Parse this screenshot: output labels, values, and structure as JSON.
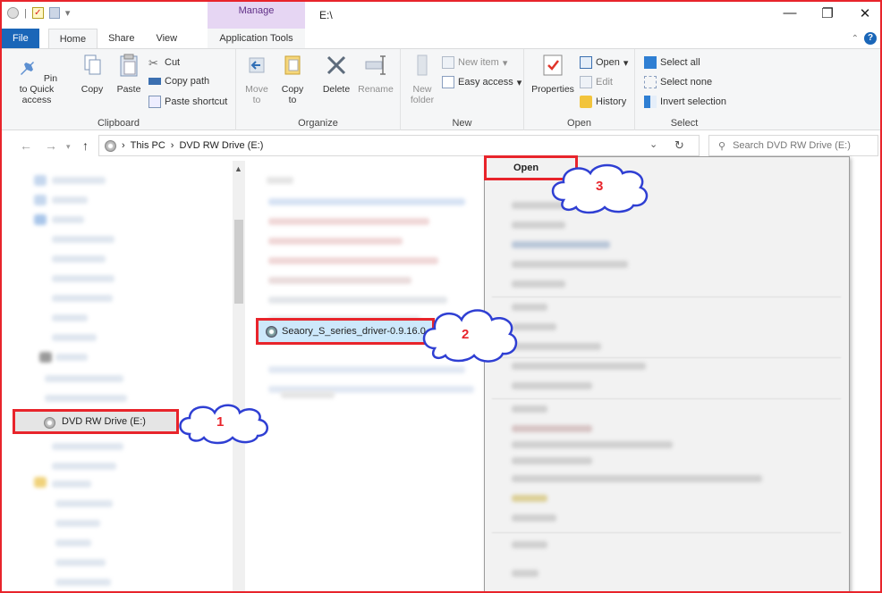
{
  "window": {
    "path_title": "E:\\",
    "manage_label": "Manage",
    "minimize": "—",
    "restore": "❐",
    "close": "✕"
  },
  "tabs": {
    "file": "File",
    "home": "Home",
    "share": "Share",
    "view": "View",
    "app_tools": "Application Tools"
  },
  "ribbon": {
    "clipboard": {
      "label": "Clipboard",
      "pin": "Pin to Quick access",
      "copy": "Copy",
      "paste": "Paste",
      "cut": "Cut",
      "copy_path": "Copy path",
      "paste_shortcut": "Paste shortcut"
    },
    "organize": {
      "label": "Organize",
      "move_to": "Move to",
      "copy_to": "Copy to",
      "delete": "Delete",
      "rename": "Rename"
    },
    "new": {
      "label": "New",
      "new_folder": "New folder",
      "new_item": "New item",
      "easy_access": "Easy access"
    },
    "open": {
      "label": "Open",
      "properties": "Properties",
      "open": "Open",
      "edit": "Edit",
      "history": "History"
    },
    "select": {
      "label": "Select",
      "select_all": "Select all",
      "select_none": "Select none",
      "invert": "Invert selection"
    }
  },
  "address": {
    "this_pc": "This PC",
    "drive": "DVD RW Drive (E:)",
    "search_placeholder": "Search DVD RW Drive (E:)"
  },
  "nav": {
    "selected_item": "DVD RW Drive (E:)"
  },
  "content": {
    "selected_file": "Seaory_S_series_driver-0.9.16.0"
  },
  "context_menu": {
    "open": "Open"
  },
  "callouts": {
    "one": "1",
    "two": "2",
    "three": "3"
  },
  "colors": {
    "accent_red": "#e8242b",
    "file_tab": "#1a66b8",
    "manage_tab": "#e6d6f3",
    "selection": "#cde8fb"
  }
}
